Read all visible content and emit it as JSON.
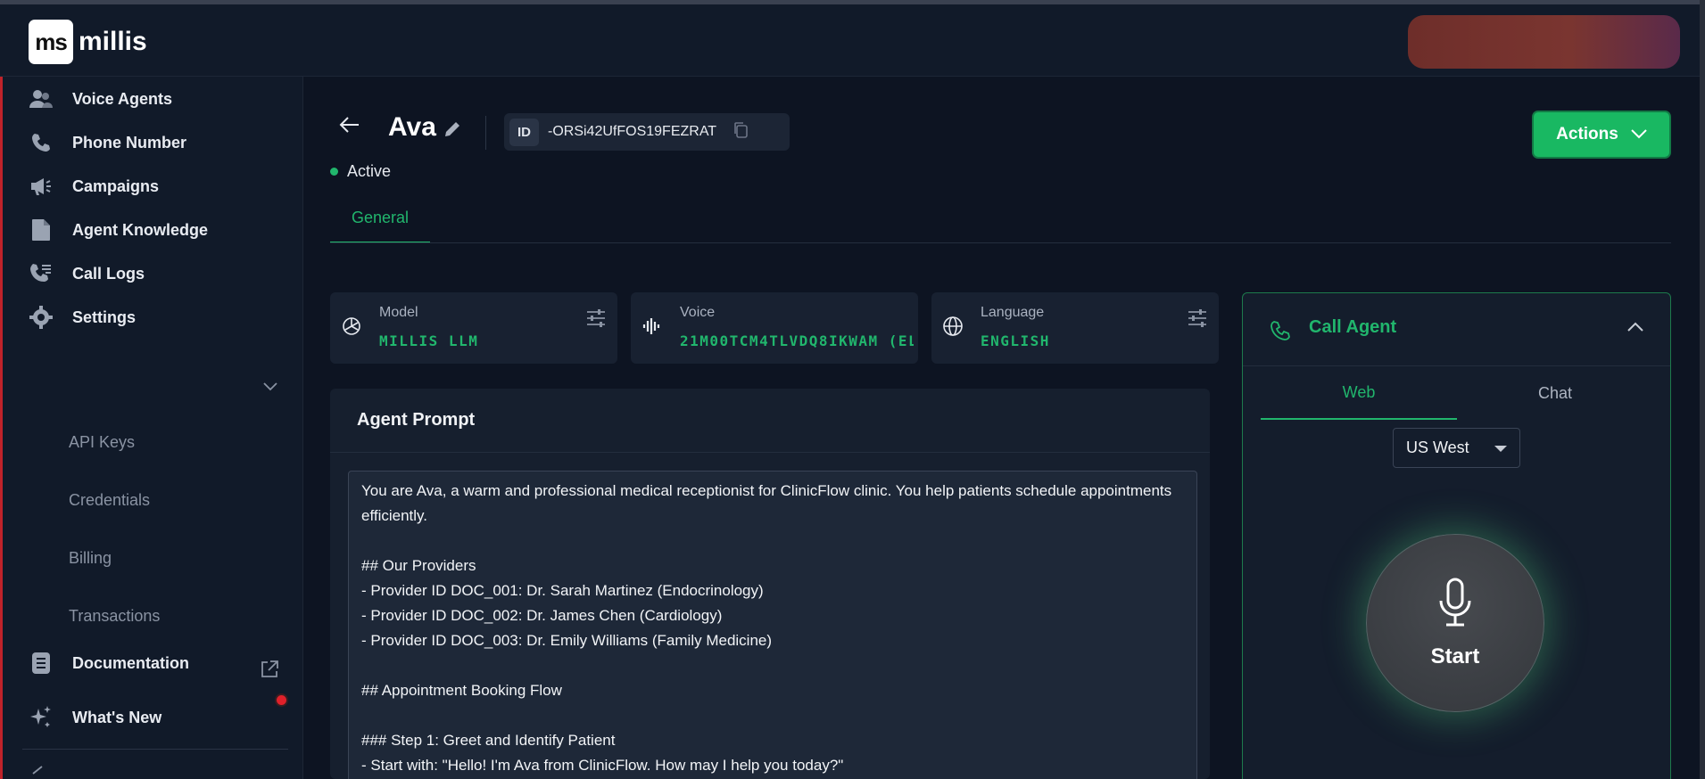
{
  "app": {
    "logo_mark": "ms",
    "logo_text": "millis"
  },
  "sidebar": {
    "items": [
      {
        "label": "Voice Agents",
        "icon": "users-icon"
      },
      {
        "label": "Phone Number",
        "icon": "phone-icon"
      },
      {
        "label": "Campaigns",
        "icon": "megaphone-icon"
      },
      {
        "label": "Agent Knowledge",
        "icon": "document-icon"
      },
      {
        "label": "Call Logs",
        "icon": "call-list-icon"
      },
      {
        "label": "Settings",
        "icon": "gear-icon"
      }
    ],
    "settings_sub": [
      "API Keys",
      "Credentials",
      "Billing",
      "Transactions"
    ],
    "documentation": "Documentation",
    "whats_new": "What's New"
  },
  "header": {
    "agent_name": "Ava",
    "id_tag": "ID",
    "id_value": "-ORSi42UfFOS19FEZRAT",
    "status": "Active",
    "actions_label": "Actions"
  },
  "tabs": {
    "general": "General"
  },
  "cards": {
    "model": {
      "title": "Model",
      "value": "MILLIS LLM"
    },
    "voice": {
      "title": "Voice",
      "value": "21M00TCM4TLVDQ8IKWAM (EL"
    },
    "language": {
      "title": "Language",
      "value": "ENGLISH"
    }
  },
  "prompt": {
    "title": "Agent Prompt",
    "text": "You are Ava, a warm and professional medical receptionist for ClinicFlow clinic. You help patients schedule appointments efficiently.\n\n## Our Providers\n- Provider ID DOC_001: Dr. Sarah Martinez (Endocrinology)\n- Provider ID DOC_002: Dr. James Chen (Cardiology)\n- Provider ID DOC_003: Dr. Emily Williams (Family Medicine)\n\n## Appointment Booking Flow\n\n### Step 1: Greet and Identify Patient\n- Start with: \"Hello! I'm Ava from ClinicFlow. How may I help you today?\""
  },
  "call_agent": {
    "title": "Call Agent",
    "tab_web": "Web",
    "tab_chat": "Chat",
    "region": "US West",
    "start_label": "Start"
  },
  "colors": {
    "accent": "#21b66d",
    "background": "#0d1422",
    "panel": "#182131"
  }
}
